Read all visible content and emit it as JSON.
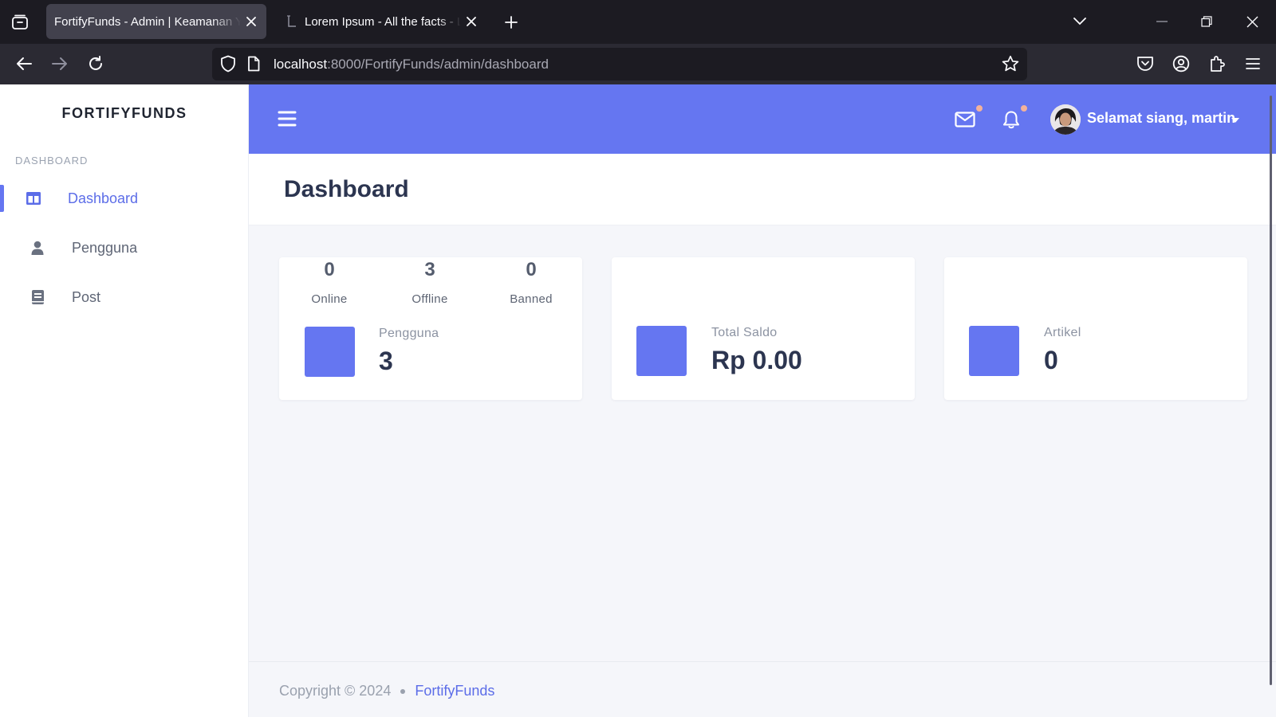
{
  "browser": {
    "tabs": [
      {
        "title": "FortifyFunds - Admin | Keamanan Ya",
        "active": true
      },
      {
        "title": "Lorem Ipsum - All the facts - Lipsum",
        "active": false
      }
    ],
    "url_host": "localhost",
    "url_path": ":8000/FortifyFunds/admin/dashboard",
    "icons": [
      "tab-list-icon",
      "close-icon",
      "new-tab-icon",
      "chevron-down-icon",
      "minimize-icon",
      "restore-icon",
      "window-close-icon",
      "back-icon",
      "forward-icon",
      "reload-icon",
      "shield-icon",
      "page-icon",
      "bookmark-star-icon",
      "pocket-icon",
      "account-icon",
      "extensions-icon",
      "menu-icon"
    ]
  },
  "sidebar": {
    "brand": "FORTIFYFUNDS",
    "section": "DASHBOARD",
    "items": [
      {
        "label": "Dashboard",
        "icon": "grid-icon",
        "active": true
      },
      {
        "label": "Pengguna",
        "icon": "user-icon",
        "active": false
      },
      {
        "label": "Post",
        "icon": "book-icon",
        "active": false
      }
    ]
  },
  "topbar": {
    "greeting": "Selamat siang, martin",
    "icons": [
      "hamburger-icon",
      "mail-icon",
      "bell-icon"
    ]
  },
  "header": {
    "title": "Dashboard"
  },
  "cards": {
    "users": {
      "stats": [
        {
          "value": "0",
          "label": "Online"
        },
        {
          "value": "3",
          "label": "Offline"
        },
        {
          "value": "0",
          "label": "Banned"
        }
      ],
      "label": "Pengguna",
      "value": "3"
    },
    "balance": {
      "label": "Total Saldo",
      "value": "Rp 0.00"
    },
    "articles": {
      "label": "Artikel",
      "value": "0"
    }
  },
  "footer": {
    "copyright": "Copyright © 2024",
    "link": "FortifyFunds"
  },
  "colors": {
    "accent": "#6576f1",
    "sidebar_bg": "#ffffff",
    "page_bg": "#f5f6fa",
    "browser_bg": "#1c1b22"
  }
}
